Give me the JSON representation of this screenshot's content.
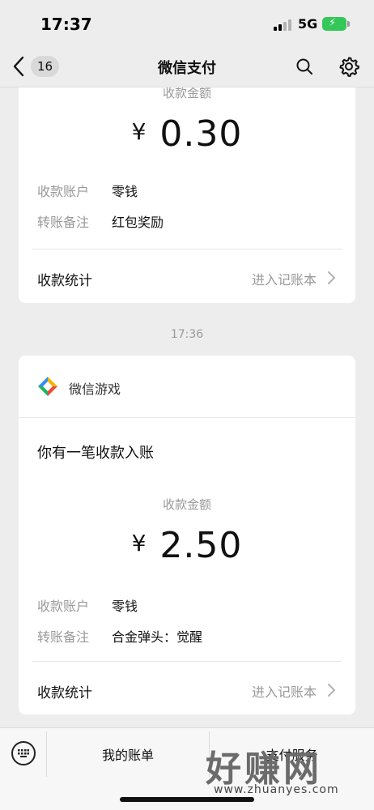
{
  "status_bar": {
    "time": "17:37",
    "network": "5G"
  },
  "nav": {
    "back_badge": "16",
    "title": "微信支付"
  },
  "card1": {
    "amount_label": "收款金额",
    "currency": "¥",
    "amount": "0.30",
    "rows": [
      {
        "key": "收款账户",
        "value": "零钱"
      },
      {
        "key": "转账备注",
        "value": "红包奖励"
      }
    ],
    "stat_label": "收款统计",
    "ledger_link": "进入记账本"
  },
  "timestamp": "17:36",
  "card2": {
    "app_name": "微信游戏",
    "notice": "你有一笔收款入账",
    "amount_label": "收款金额",
    "currency": "¥",
    "amount": "2.50",
    "rows": [
      {
        "key": "收款账户",
        "value": "零钱"
      },
      {
        "key": "转账备注",
        "value": "合金弹头：觉醒"
      }
    ],
    "stat_label": "收款统计",
    "ledger_link": "进入记账本"
  },
  "bottom_menu": {
    "item1": "我的账单",
    "item2": "支付服务"
  },
  "watermark": {
    "text": "好赚网",
    "url": "www.zhuanyes.com"
  }
}
